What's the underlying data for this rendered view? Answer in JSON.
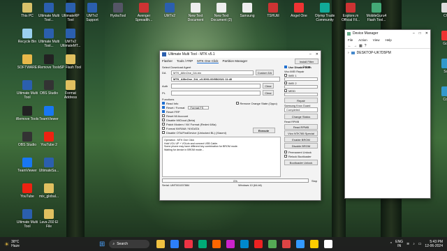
{
  "desktop": {
    "icons_left": [
      {
        "label": "This PC",
        "color": "#d8c16a"
      },
      {
        "label": "Recycle Bin",
        "color": "#9ad0ef"
      },
      {
        "label": "SOFTWARE",
        "color": "#e8b84a"
      },
      {
        "label": "Ultimate Multi Tool",
        "color": "#2b5fae"
      },
      {
        "label": "iRemove Tools",
        "color": "#222"
      },
      {
        "label": "OBS Studio",
        "color": "#333"
      },
      {
        "label": "TeamViewer",
        "color": "#1877f2"
      },
      {
        "label": "YouTube",
        "color": "#e21"
      },
      {
        "label": "Ultimate Multi Tool",
        "color": "#2b5fae"
      }
    ],
    "icons_col2": [
      {
        "label": "Ultimate Multi Tool...",
        "color": "#2b5fae"
      },
      {
        "label": "Ultimate Multi Tool...",
        "color": "#2b5fae"
      },
      {
        "label": "iRemove Tools",
        "color": "#222"
      },
      {
        "label": "OBS Studio",
        "color": "#333"
      },
      {
        "label": "TeamViewer",
        "color": "#1877f2"
      },
      {
        "label": "YouTube 2",
        "color": "#e21"
      },
      {
        "label": "UltimateSa...",
        "color": "#2b5fae"
      },
      {
        "label": "mix_global...",
        "color": "#e0c060"
      },
      {
        "label": "Lava Z60 El File",
        "color": "#e0c060"
      }
    ],
    "icons_col3": [
      {
        "label": "UltimateRP Tool",
        "color": "#2b5fae"
      },
      {
        "label": "UMTv2 UltimateMT...",
        "color": "#2b5fae"
      },
      {
        "label": "SP Flash Tool",
        "color": "#e0c060"
      },
      {
        "label": "Format Address",
        "color": "#e0c060"
      }
    ],
    "icons_top": [
      {
        "label": "UMTv2 Support",
        "color": "#2b5fae"
      },
      {
        "label": "HydraTool",
        "color": "#556"
      },
      {
        "label": "Avenger Spreadth...",
        "color": "#c33"
      },
      {
        "label": "UMTv2",
        "color": "#2b5fae"
      },
      {
        "label": "New Text Document",
        "color": "#eee"
      },
      {
        "label": "New Text Document (2)",
        "color": "#eee"
      },
      {
        "label": "Samsung",
        "color": "#eee"
      },
      {
        "label": "TSHUtil",
        "color": "#c33"
      },
      {
        "label": "Angel One",
        "color": "#e33"
      },
      {
        "label": "Olymp Trade Community",
        "color": "#1a9"
      },
      {
        "label": "Explore.m Official Fil...",
        "color": "#c33"
      },
      {
        "label": "MobileGuru4 Flash Tool...",
        "color": "#4a7"
      }
    ],
    "icons_right": [
      {
        "label": "Chr",
        "color": "#ddd"
      },
      {
        "label": "Goo",
        "color": "#e33"
      },
      {
        "label": "Scr",
        "color": "#39c"
      },
      {
        "label": "Con",
        "color": "#39c"
      }
    ]
  },
  "umt": {
    "title": "Ultimate Multi Tool - MTK v5.1",
    "tabs": [
      "Flasher",
      "Tools / FRP",
      "MTK One Click",
      "Partition Manager"
    ],
    "install_btn": "Install Filter Driver",
    "use_disable_auth": "Use Disable Auth",
    "select_download_agent": "Select Download Agent",
    "da_label": "DA",
    "da_value": "MTK_AllInOne_DA.bin",
    "custom_da": "Custom DA",
    "da_info": "MTK_AllInOne_DA_v3.3001.00/05/2021 11:40",
    "auth_label": "Auth",
    "pl_label": "PL",
    "clear": "Clear",
    "functions_label": "Functions",
    "checks": [
      {
        "label": "Read Info",
        "checked": true
      },
      {
        "label": "Reset / Format",
        "checked": true
      },
      {
        "label": "Reset FRP",
        "checked": true
      },
      {
        "label": "Reset Mi Account",
        "checked": false
      },
      {
        "label": "Disable MiCloud (Beta)",
        "checked": false
      },
      {
        "label": "Patch Modem / NV Format (Redmi 6/6a)",
        "checked": false
      },
      {
        "label": "Format NVRAM / NVDATA",
        "checked": false
      },
      {
        "label": "Disable OTA/FindDevice (Unlocked BL) (Xiaomi)",
        "checked": false
      }
    ],
    "format_select": "Format FS",
    "remove_orange": "Remove Orange State (Oppo)",
    "execute": "Execute",
    "log_lines": [
      "Operation : MTK One Click",
      "Hold VOL UP + VOLdn and connect USB Cable.",
      "Some phone may have different key combination for BROM mode.",
      "Waiting for device in BROM mode..."
    ],
    "progress_text": "0%",
    "stop": "Stop",
    "serial": "Serial: UMT001007884",
    "os": "Windows 10 (64-bit)",
    "vivo_label": "Vivo IMEI Repair",
    "imei1": "IMEI 1",
    "imei2": "IMEI 2",
    "meid": "MEID",
    "repair": "Repair",
    "samsung_label": "Samsung Knox Guard",
    "knox_select": "Completed",
    "change_status": "Change Status",
    "read_rpmb_label": "Read RPMB",
    "read_rpmb": "Read RPMB",
    "vivo_special": "Vivo NTK785 Special",
    "enable_brom": "Enable BROM",
    "disable_brom": "Disable BROM",
    "permanent_unlock": "Permanent Unlock",
    "relock": "Relock Bootloader",
    "bootloader_unlock": "Bootloader Unlock"
  },
  "devmgr": {
    "title": "Device Manager",
    "menu": [
      "File",
      "Action",
      "View",
      "Help"
    ],
    "tree_root": "DESKTOP-UK7D5PM"
  },
  "taskbar": {
    "weather_temp": "38°C",
    "weather_desc": "Haze",
    "search": "Search",
    "lang": "ENG",
    "region": "IN",
    "time": "5:43 PM",
    "date": "12-06-2024"
  }
}
